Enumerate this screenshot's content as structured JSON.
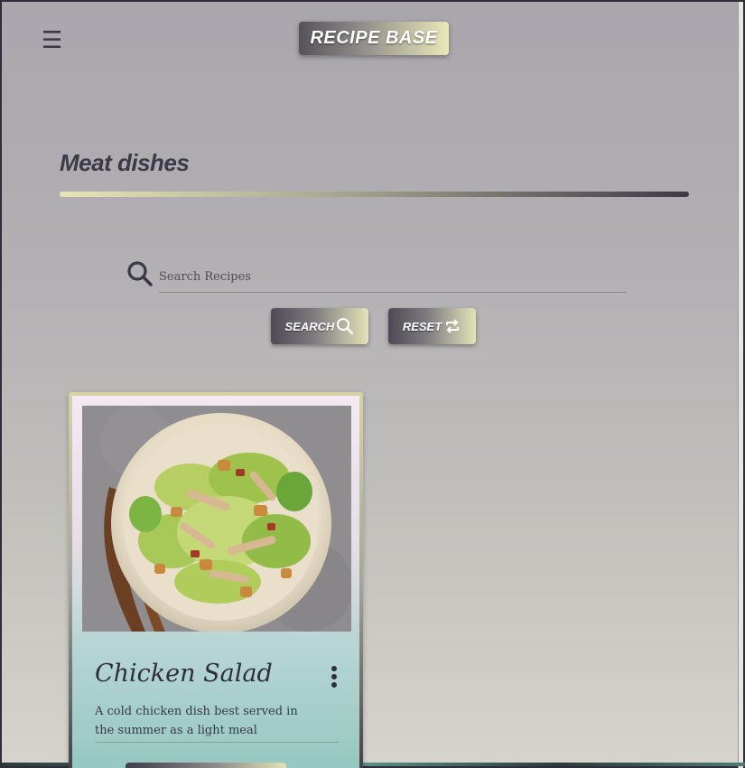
{
  "header": {
    "menu_icon": "hamburger-menu-icon",
    "brand": "RECIPE BASE"
  },
  "page": {
    "title": "Meat dishes"
  },
  "search": {
    "icon": "search-icon",
    "placeholder": "Search Recipes",
    "value": "",
    "search_label": "SEARCH",
    "search_icon": "magnifier-icon",
    "reset_label": "RESET",
    "reset_icon": "refresh-icon"
  },
  "recipes": [
    {
      "title": "Chicken Salad",
      "description": "A cold chicken dish best served in the summer as a light meal",
      "image": "chicken-caesar-salad-photo",
      "menu_icon": "more-vertical-icon"
    }
  ],
  "colors": {
    "accent_dark": "#3d3a48",
    "accent_light": "#e6e5b8",
    "card_teal": "#95c8bf"
  }
}
